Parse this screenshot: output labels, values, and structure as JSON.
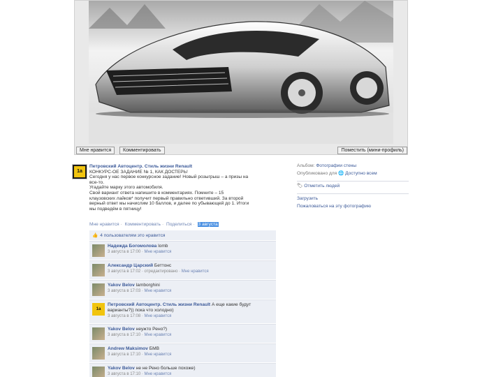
{
  "photo": {
    "like_btn": "Мне нравится",
    "comment_btn": "Комментировать",
    "profile_btn": "Поместить (мини-профиль)"
  },
  "post": {
    "avatar_text": "1a",
    "author": "Петровский Автоцентр. Стиль жизни Renault",
    "lines": [
      "КОНКУРС-ОЕ ЗАДАНИЕ № 1, КАК ДОСТЕРЬ!",
      "Сегодня у нас первое конкурсное задание! Новый розыгрыш – а призы на",
      "все-то.",
      "Угадайте марку этого автомобиля.",
      "Свой вариант ответа напишите в комментариях. Помните – 15",
      "клаузовских лайков* получит первый правильно ответивший. За второй",
      "верный ответ мы начислим 10 баллов, и далее по убывающей до 1. Итоги",
      "мы подведём в пятницу!"
    ],
    "actions": {
      "like": "Мне нравится",
      "comment": "Комментировать",
      "share": "Поделиться",
      "date": "3 августа"
    }
  },
  "likes_bar": "4 пользователям это нравится",
  "comments": [
    {
      "name": "Надежда Богомолова",
      "text": "lomb",
      "meta": "3 августа в 17:00",
      "like": "Мне нравится",
      "page": false
    },
    {
      "name": "Александр Царский",
      "text": "Беттонс",
      "meta": "3 августа в 17:02 · отредактировано",
      "like": "Мне нравится",
      "page": false
    },
    {
      "name": "Yakov Belov",
      "text": "lamborghini",
      "meta": "3 августа в 17:03",
      "like": "Мне нравится",
      "page": false
    },
    {
      "name": "Петровский Автоцентр. Стиль жизни Renault",
      "text": "А еще какие будут варианты?)) пока что холодно)",
      "meta": "3 августа в 17:08",
      "like": "Мне нравится",
      "page": true
    },
    {
      "name": "Yakov Belov",
      "text": "неужто Рено?)",
      "meta": "3 августа в 17:10",
      "like": "Мне нравится",
      "page": false
    },
    {
      "name": "Andrew Maksimov",
      "text": "БМВ",
      "meta": "3 августа в 17:10",
      "like": "Мне нравится",
      "page": false
    },
    {
      "name": "Yakov Belov",
      "text": "не не Рено больше похоже)",
      "meta": "3 августа в 17:10",
      "like": "Мне нравится",
      "page": false
    }
  ],
  "sidebar": {
    "album_label": "Альбом:",
    "album_value": "Фотографии стены",
    "published_label": "Опубликовано для",
    "published_value": "Доступно всем",
    "tag_link": "Отметить людей",
    "download_link": "Загрузить",
    "report_link": "Пожаловаться на эту фотографию"
  }
}
